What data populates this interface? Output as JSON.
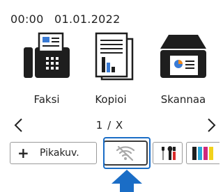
{
  "status": {
    "time": "00:00",
    "date": "01.01.2022"
  },
  "apps": [
    {
      "label": "Faksi",
      "icon": "fax-icon"
    },
    {
      "label": "Kopioi",
      "icon": "copy-icon"
    },
    {
      "label": "Skannaa",
      "icon": "scan-icon"
    }
  ],
  "pager": {
    "indicator": "1 / X",
    "prev_icon": "chevron-left-icon",
    "next_icon": "chevron-right-icon"
  },
  "shortcut_bar": {
    "shortcut_label": "Pikakuv.",
    "plus_symbol": "+",
    "wifi_icon": "wifi-off-icon",
    "tools_icon": "tools-icon",
    "ink_icon": "ink-cartridges-icon"
  },
  "colors": {
    "highlight": "#1a6dc6",
    "arrow": "#1a6dc6",
    "icon_dark": "#1e1e1e",
    "scan_accent": "#3a7bd5",
    "scan_orange": "#f08a1c",
    "ink_black": "#1e1e1e",
    "ink_cyan": "#2aa6d8",
    "ink_magenta": "#d0287c",
    "ink_yellow": "#f2d21b",
    "tools_red": "#d82a2a"
  }
}
